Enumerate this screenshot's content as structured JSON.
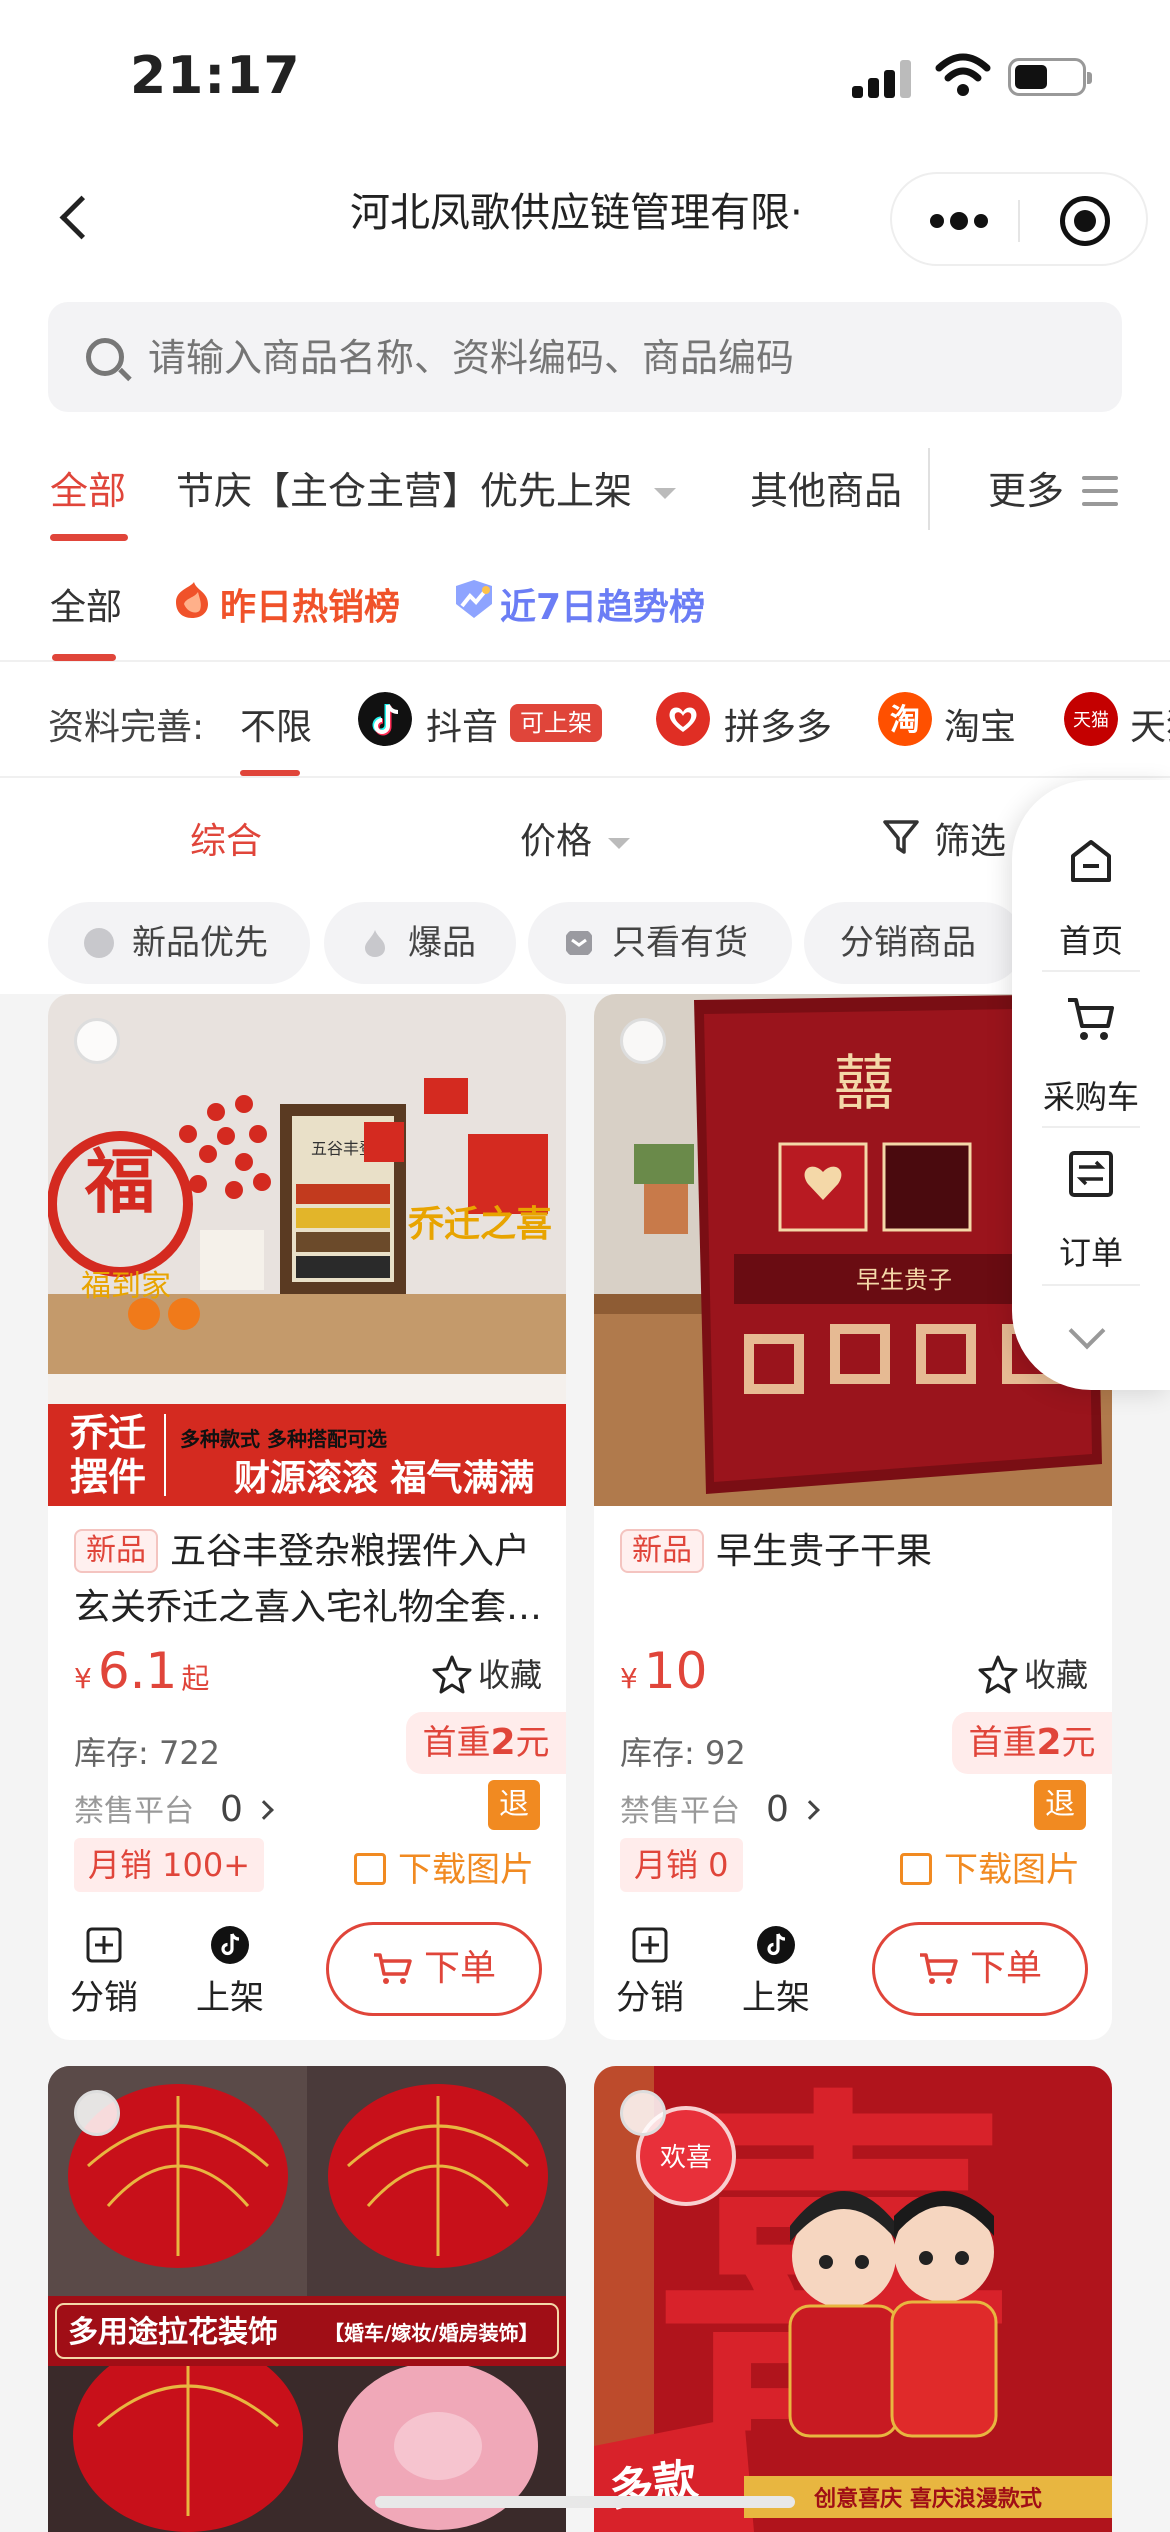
{
  "status_bar": {
    "time": "21:17"
  },
  "nav": {
    "title": "河北凤歌供应链管理有限·"
  },
  "search": {
    "placeholder": "请输入商品名称、资料编码、商品编码"
  },
  "category_tabs": [
    {
      "label": "全部",
      "active": true
    },
    {
      "label": "节庆【主仓主营】优先上架",
      "active": false
    },
    {
      "label": "其他商品",
      "active": false
    },
    {
      "label": "更多",
      "active": false
    }
  ],
  "rank_tabs": {
    "all": "全部",
    "hot": "昨日热销榜",
    "trend": "近7日趋势榜"
  },
  "platform_filter": {
    "label": "资料完善:",
    "all": "不限",
    "platforms": [
      {
        "name": "抖音",
        "icon": "douyin-icon",
        "tag": "可上架",
        "color": "#111111"
      },
      {
        "name": "拼多多",
        "icon": "pinduoduo-icon",
        "color": "#e02e24"
      },
      {
        "name": "淘宝",
        "icon": "taobao-icon",
        "color": "#ff5000"
      },
      {
        "name": "天猫",
        "icon": "tmall-icon",
        "color": "#c40000"
      }
    ]
  },
  "sort": {
    "comprehensive": "综合",
    "price": "价格",
    "filter": "筛选"
  },
  "quick_filters": [
    "新品优先",
    "爆品",
    "只看有货",
    "分销商品"
  ],
  "side_menu": {
    "home": "首页",
    "cart": "采购车",
    "orders": "订单"
  },
  "products": [
    {
      "badge": "新品",
      "title": "五谷丰登杂粮摆件入户玄关乔迁之喜入宅礼物全套…",
      "price": "6.1",
      "price_suffix": "起",
      "currency": "¥",
      "favorite": "收藏",
      "stock": "库存: 722",
      "weight_prefix": "首重",
      "weight_value": "2",
      "weight_unit": "元",
      "banned_label": "禁售平台",
      "banned_count": "0",
      "refund": "退",
      "monthly_sales": "月销 100+",
      "download": "下载图片",
      "distribute": "分销",
      "list": "上架",
      "order": "下单",
      "image_text": {
        "big": "乔迁\n摆件",
        "small": "多种款式 多种搭配可选",
        "slogan": "财源滚滚 福气满满",
        "fu": "福",
        "fu_sub": "福到家",
        "joy": "乔迁之喜",
        "frame": "五谷丰登"
      }
    },
    {
      "badge": "新品",
      "title": "早生贵子干果",
      "price": "10",
      "price_suffix": "",
      "currency": "¥",
      "favorite": "收藏",
      "stock": "库存: 92",
      "weight_prefix": "首重",
      "weight_value": "2",
      "weight_unit": "元",
      "banned_label": "禁售平台",
      "banned_count": "0",
      "refund": "退",
      "monthly_sales": "月销 0",
      "download": "下载图片",
      "distribute": "分销",
      "list": "上架",
      "order": "下单",
      "image_text": {
        "xi": "囍",
        "line": "早生贵子"
      }
    },
    {
      "image_text": {
        "banner": "多用途拉花装饰",
        "sub": "【婚车/嫁妆/婚房装饰】"
      }
    },
    {
      "image_text": {
        "xi": "喜",
        "small": "欢喜",
        "corner": "多款",
        "strip": "创意喜庆 喜庆浪漫款式"
      }
    }
  ],
  "colors": {
    "accent": "#e0453a",
    "orange": "#f18a21",
    "trend": "#6b7df5"
  }
}
